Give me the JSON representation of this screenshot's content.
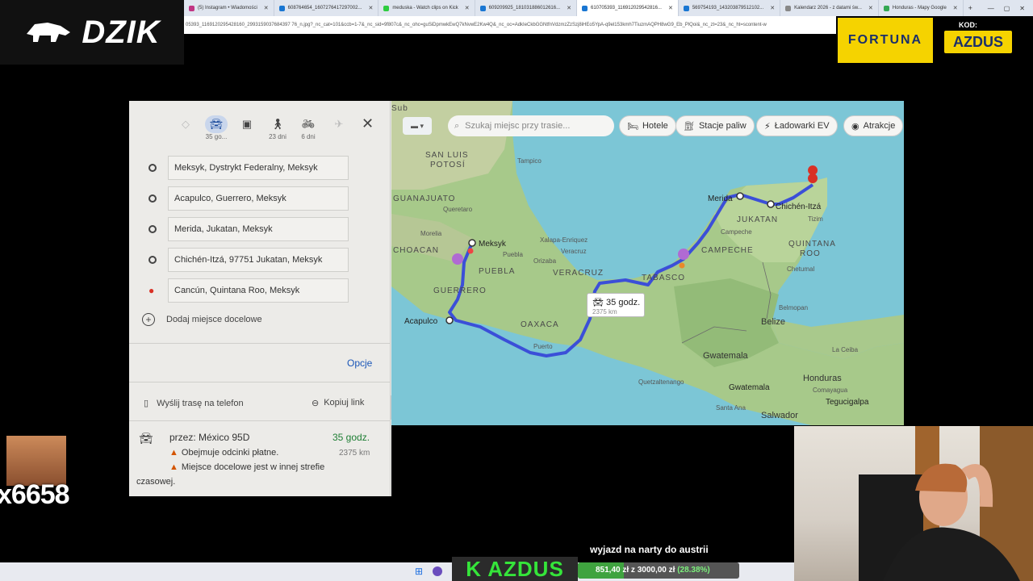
{
  "browser": {
    "tabs": [
      {
        "label": "(5) Instagram • Wiadomości",
        "active": false
      },
      {
        "label": "608764654_1607276417297002...",
        "active": false
      },
      {
        "label": "meduska - Watch clips on Kick",
        "active": false
      },
      {
        "label": "609209925_181031886012616...",
        "active": false
      },
      {
        "label": "610705393_116912029542816...",
        "active": true
      },
      {
        "label": "569754193_143203879512102...",
        "active": false
      },
      {
        "label": "Kalendarz 2026 - z datami św...",
        "active": false
      },
      {
        "label": "Honduras - Mapy Google",
        "active": false
      }
    ],
    "new_tab": "+",
    "window_controls": [
      "—",
      "▢",
      "✕"
    ],
    "url": "05393_1169120295428160_2993159037684397 76_n.jpg?_nc_cat=101&ccb=1-7&_nc_sid=9f807c&_nc_ohc=guSiDpmwkEwQ7kNvwE2Kw4Q&_nc_oc=AdkIeCkbGGNtfnVdzmzZzSzj8iHEo5YpA-q9el153kmh7TiuzmAQPH8wG9_Eb_PlQoi&_nc_zt=23&_nc_ht=scontent-w"
  },
  "branding": {
    "dzik": "DZIK",
    "fortuna": "FORTUNA",
    "kod_label": "KOD:",
    "kod_value": "AZDUS"
  },
  "directions_panel": {
    "modes": [
      {
        "icon": "best-icon",
        "label": ""
      },
      {
        "icon": "car-icon",
        "label": "35 go..."
      },
      {
        "icon": "transit-icon",
        "label": ""
      },
      {
        "icon": "walk-icon",
        "label": "23 dni"
      },
      {
        "icon": "bike-icon",
        "label": "6 dni"
      },
      {
        "icon": "flight-icon",
        "label": ""
      }
    ],
    "stops": [
      "Meksyk, Dystrykt Federalny, Meksyk",
      "Acapulco, Guerrero, Meksyk",
      "Merida, Jukatan, Meksyk",
      "Chichén-Itzá, 97751 Jukatan, Meksyk",
      "Cancún, Quintana Roo, Meksyk"
    ],
    "add_destination": "Dodaj miejsce docelowe",
    "options": "Opcje",
    "send_to_phone": "Wyślij trasę na telefon",
    "copy_link": "Kopiuj link",
    "route": {
      "via": "przez: México 95D",
      "duration": "35 godz.",
      "distance": "2375 km",
      "warning_1": "Obejmuje odcinki płatne.",
      "warning_2": "Miejsce docelowe jest w innej strefie",
      "warning_2b": "czasowej."
    }
  },
  "map": {
    "search_placeholder": "Szukaj miejsc przy trasie...",
    "chips": [
      "Hotele",
      "Stacje paliw",
      "Ładowarki EV",
      "Atrakcje"
    ],
    "badge_time": "35 godz.",
    "badge_distance": "2375 km",
    "labels": {
      "san_luis": "SAN LUIS",
      "potosi": "POTOSÍ",
      "tampico": "Tampico",
      "guanajuato": "GUANAJUATO",
      "queretaro": "Queretaro",
      "morelia": "Morelia",
      "meksyk": "Meksyk",
      "choacan": "CHOACAN",
      "xalapa": "Xalapa-Enriquez",
      "veracruz_city": "Veracruz",
      "puebla_city": "Puebla",
      "puebla": "PUEBLA",
      "orizaba": "Orizaba",
      "veracruz": "VERACRUZ",
      "guerrero": "GUERRERO",
      "acapulco": "Acapulco",
      "oaxaca": "OAXACA",
      "puerto": "Puerto",
      "tabasco": "TABASCO",
      "campeche": "CAMPECHE",
      "campeche_city": "Campeche",
      "merida": "Merida",
      "jukatan": "JUKATAN",
      "chichen": "Chichén-Itzá",
      "tizimin": "Tizim",
      "quintana": "QUINTANA",
      "roo": "ROO",
      "chetumal": "Chetumal",
      "belmopan": "Belmopan",
      "belize": "Belize",
      "gwatemala_country": "Gwatemala",
      "gwatemala_city": "Gwatemala",
      "quetzaltenango": "Quetzaltenango",
      "la_ceiba": "La Ceiba",
      "honduras": "Honduras",
      "comayagua": "Comayagua",
      "tegucigalpa": "Tegucigalpa",
      "santa_ana": "Santa Ana",
      "salwador": "Salwador",
      "sub": "Sub"
    }
  },
  "stream": {
    "chat_count": "x6658",
    "caption": "wyjazd na narty do austrii",
    "kazdus": "K AZDUS",
    "goal_text": "851,40 zł z 3000,00 zł",
    "goal_pct": "(28.38%)",
    "goal_fraction": 0.2838
  },
  "colors": {
    "route": "#3b4fd8",
    "accent_yellow": "#f5d300",
    "kazdus_green": "#35e53a"
  }
}
